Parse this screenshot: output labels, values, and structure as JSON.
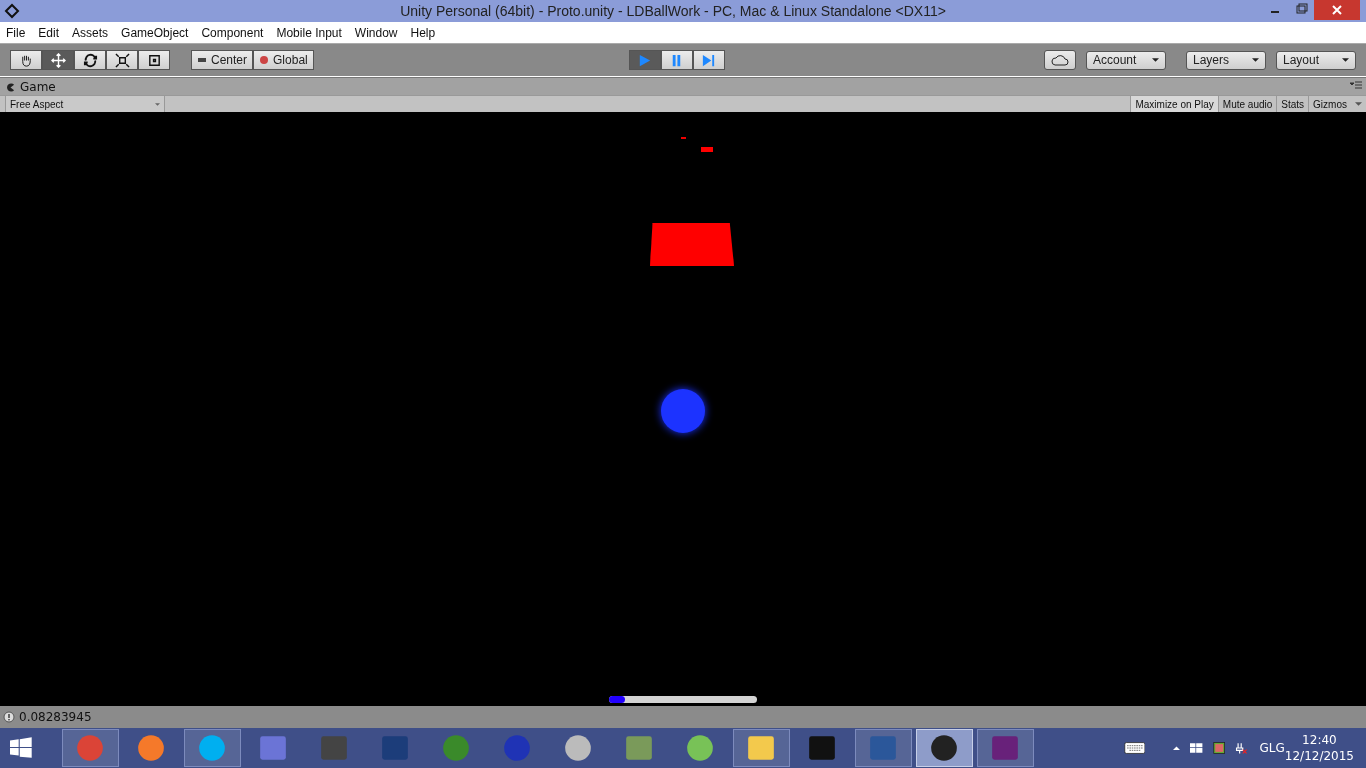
{
  "window": {
    "title": "Unity Personal (64bit) - Proto.unity - LDBallWork - PC, Mac & Linux Standalone <DX11>"
  },
  "menu": [
    "File",
    "Edit",
    "Assets",
    "GameObject",
    "Component",
    "Mobile Input",
    "Window",
    "Help"
  ],
  "toolbar": {
    "tools": [
      {
        "selected": false
      },
      {
        "selected": true
      },
      {
        "selected": false
      },
      {
        "selected": false
      },
      {
        "selected": false
      }
    ],
    "pivot": [
      "Center",
      "Global"
    ],
    "playback": [
      {
        "selected": true
      },
      {
        "selected": false
      },
      {
        "selected": false
      }
    ],
    "account": "Account",
    "layers": "Layers",
    "layout": "Layout"
  },
  "game_panel": {
    "tab": "Game",
    "aspect": "Free Aspect",
    "toggles": [
      {
        "label": "Maximize on Play",
        "selected": true
      },
      {
        "label": "Mute audio",
        "selected": false
      },
      {
        "label": "Stats",
        "selected": false
      },
      {
        "label": "Gizmos",
        "selected": false
      }
    ],
    "progress": {
      "level": 0.11
    }
  },
  "status_bar": {
    "message": "0.08283945"
  },
  "taskbar": {
    "apps": [
      {
        "open": true,
        "selected": false
      },
      {
        "open": false,
        "selected": false
      },
      {
        "open": true,
        "selected": false
      },
      {
        "open": false,
        "selected": false
      },
      {
        "open": false,
        "selected": false
      },
      {
        "open": false,
        "selected": false
      },
      {
        "open": false,
        "selected": false
      },
      {
        "open": false,
        "selected": false
      },
      {
        "open": false,
        "selected": false
      },
      {
        "open": false,
        "selected": false
      },
      {
        "open": false,
        "selected": false
      },
      {
        "open": true,
        "selected": false
      },
      {
        "open": false,
        "selected": false
      },
      {
        "open": true,
        "selected": false
      },
      {
        "open": true,
        "selected": true
      },
      {
        "open": true,
        "selected": false
      }
    ],
    "language": "GLG",
    "time": "12:40",
    "date": "12/12/2015"
  }
}
